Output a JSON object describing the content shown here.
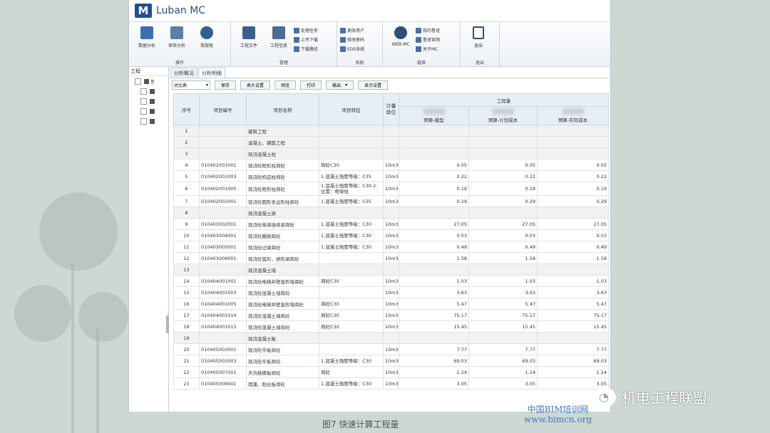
{
  "app": {
    "logo": "M",
    "title": "Luban MC"
  },
  "ribbon": {
    "groups": [
      {
        "label": "操作",
        "big": [
          {
            "label": "数据分析",
            "icon": "chart-icon"
          },
          {
            "label": "审核分析",
            "icon": "audit-icon"
          },
          {
            "label": "驾驶舱",
            "icon": "dashboard-icon"
          }
        ],
        "small": []
      },
      {
        "label": "管理",
        "big": [
          {
            "label": "工程文件",
            "icon": "file-icon"
          },
          {
            "label": "工程信息",
            "icon": "info-icon"
          }
        ],
        "small": [
          {
            "label": "处理任务",
            "icon": "task-icon"
          },
          {
            "label": "上传下载",
            "icon": "upload-icon"
          },
          {
            "label": "下载路径",
            "icon": "folder-icon"
          }
        ]
      },
      {
        "label": "系统",
        "big": [],
        "small": [
          {
            "label": "更改用户",
            "icon": "user-icon"
          },
          {
            "label": "修改密码",
            "icon": "lock-icon"
          },
          {
            "label": "EDS系统",
            "icon": "system-icon"
          }
        ]
      },
      {
        "label": "链接",
        "big": [
          {
            "label": "WEB-MC",
            "icon": "web-icon"
          }
        ],
        "small": [
          {
            "label": "我的鲁班",
            "icon": "home-icon"
          },
          {
            "label": "鲁班官网",
            "icon": "globe-icon"
          },
          {
            "label": "关于MC",
            "icon": "about-icon"
          }
        ]
      },
      {
        "label": "退出",
        "big": [
          {
            "label": "退出",
            "icon": "exit-icon"
          }
        ],
        "small": []
      }
    ]
  },
  "left_panel": {
    "header": "工程",
    "root_label": "鲁"
  },
  "tabs": [
    {
      "label": "分析概况"
    },
    {
      "label": "分析明细"
    }
  ],
  "toolbar": {
    "select_value": "对比表",
    "buttons": [
      "保存",
      "表头设置",
      "预览",
      "打印",
      "输出",
      "显示设置"
    ]
  },
  "table": {
    "headers": {
      "seq": "序号",
      "code": "项目编号",
      "name": "项目名称",
      "feature": "项目特征",
      "unit": "计量单位",
      "quantity": "工程量",
      "sub1": "预算-模型",
      "sub2": "预算-计划成本",
      "sub3": "预算-实际成本"
    },
    "rows": [
      {
        "seq": "1",
        "code": "",
        "name": "建筑工程",
        "feature": "",
        "unit": "",
        "v1": "",
        "v2": "",
        "v3": "",
        "group": true
      },
      {
        "seq": "2",
        "code": "",
        "name": "混凝土、钢筋工程",
        "feature": "",
        "unit": "",
        "v1": "",
        "v2": "",
        "v3": "",
        "group": true
      },
      {
        "seq": "3",
        "code": "",
        "name": "现浇混凝土柱",
        "feature": "",
        "unit": "",
        "v1": "",
        "v2": "",
        "v3": "",
        "group": true
      },
      {
        "seq": "4",
        "code": "010402001001",
        "name": "现浇砼矩形柱商砼",
        "feature": "商砼C30",
        "unit": "10m3",
        "v1": "0.05",
        "v2": "0.05",
        "v3": "0.05"
      },
      {
        "seq": "5",
        "code": "010402001003",
        "name": "现浇砼构造柱商砼",
        "feature": "1.混凝土强度等级：C35",
        "unit": "10m3",
        "v1": "0.22",
        "v2": "0.22",
        "v3": "0.22"
      },
      {
        "seq": "6",
        "code": "010402001005",
        "name": "现浇砼矩形柱商砼",
        "feature": "1.混凝土强度等级：C30 2.位置：框架柱",
        "unit": "10m3",
        "v1": "0.19",
        "v2": "0.19",
        "v3": "0.19"
      },
      {
        "seq": "7",
        "code": "010402002001",
        "name": "现浇砼圆形多边形柱商砼",
        "feature": "1.混凝土强度等级：C35",
        "unit": "10m3",
        "v1": "0.29",
        "v2": "0.29",
        "v3": "0.29"
      },
      {
        "seq": "8",
        "code": "",
        "name": "现浇混凝土梁",
        "feature": "",
        "unit": "",
        "v1": "",
        "v2": "",
        "v3": "",
        "group": true
      },
      {
        "seq": "9",
        "code": "010403002001",
        "name": "现浇砼单梁连续梁商砼",
        "feature": "1.混凝土强度等级：C30",
        "unit": "10m3",
        "v1": "27.05",
        "v2": "27.05",
        "v3": "27.05"
      },
      {
        "seq": "10",
        "code": "010403004001",
        "name": "现浇砼圈梁商砼",
        "feature": "1.混凝土强度等级：C30",
        "unit": "10m3",
        "v1": "0.03",
        "v2": "0.03",
        "v3": "0.03"
      },
      {
        "seq": "11",
        "code": "010403005001",
        "name": "现浇砼过梁商砼",
        "feature": "1.混凝土强度等级：C30",
        "unit": "10m3",
        "v1": "0.49",
        "v2": "0.49",
        "v3": "0.49"
      },
      {
        "seq": "12",
        "code": "010403006001",
        "name": "现浇砼弧形、拱形梁商砼",
        "feature": "",
        "unit": "10m3",
        "v1": "1.58",
        "v2": "1.58",
        "v3": "1.58"
      },
      {
        "seq": "13",
        "code": "",
        "name": "现浇混凝土墙",
        "feature": "",
        "unit": "",
        "v1": "",
        "v2": "",
        "v3": "",
        "group": true
      },
      {
        "seq": "14",
        "code": "010404001001",
        "name": "现浇砼电梯井壁直形墙商砼",
        "feature": "商砼C30",
        "unit": "10m3",
        "v1": "1.03",
        "v2": "1.03",
        "v3": "1.03"
      },
      {
        "seq": "15",
        "code": "010404001003",
        "name": "现浇砼混凝土墙商砼",
        "feature": "",
        "unit": "10m3",
        "v1": "3.63",
        "v2": "3.63",
        "v3": "3.63"
      },
      {
        "seq": "16",
        "code": "010404001005",
        "name": "现浇砼电梯井壁直形墙商砼",
        "feature": "商砼C30",
        "unit": "10m3",
        "v1": "5.47",
        "v2": "5.47",
        "v3": "5.47"
      },
      {
        "seq": "17",
        "code": "010404001014",
        "name": "现浇砼混凝土墙商砼",
        "feature": "商砼C30",
        "unit": "10m3",
        "v1": "75.17",
        "v2": "75.17",
        "v3": "75.17"
      },
      {
        "seq": "18",
        "code": "010404001015",
        "name": "现浇砼混凝土墙商砼",
        "feature": "商砼C30",
        "unit": "10m3",
        "v1": "15.45",
        "v2": "15.45",
        "v3": "15.45"
      },
      {
        "seq": "19",
        "code": "",
        "name": "现浇混凝土板",
        "feature": "",
        "unit": "",
        "v1": "",
        "v2": "",
        "v3": "",
        "group": true
      },
      {
        "seq": "20",
        "code": "010405003001",
        "name": "现浇砼平板商砼",
        "feature": "",
        "unit": "10m3",
        "v1": "7.77",
        "v2": "7.77",
        "v3": "7.77"
      },
      {
        "seq": "21",
        "code": "010405003003",
        "name": "现浇砼平板商砼",
        "feature": "1.混凝土强度等级：C30",
        "unit": "10m3",
        "v1": "69.03",
        "v2": "69.03",
        "v3": "69.03"
      },
      {
        "seq": "22",
        "code": "010405007001",
        "name": "天沟挑檐板商砼",
        "feature": "商砼",
        "unit": "10m3",
        "v1": "1.24",
        "v2": "1.24",
        "v3": "1.24"
      },
      {
        "seq": "23",
        "code": "010405008001",
        "name": "雨篷、阳台板商砼",
        "feature": "1.混凝土强度等级：C30",
        "unit": "10m3",
        "v1": "3.05",
        "v2": "3.05",
        "v3": "3.05"
      }
    ]
  },
  "caption": "图7 快速计算工程量",
  "watermark": {
    "text": "机电工程联盟",
    "site_cn": "中国BIM培训网",
    "site_url": "www.bimcn.org"
  }
}
